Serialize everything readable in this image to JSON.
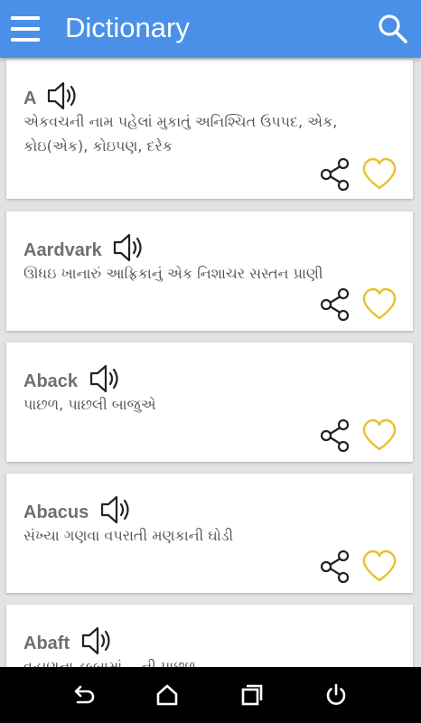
{
  "app": {
    "title": "Dictionary"
  },
  "icons": {
    "menu": "hamburger-menu-icon",
    "search": "search-icon",
    "speaker": "speaker-icon",
    "share": "share-icon",
    "favorite": "heart-icon"
  },
  "colors": {
    "appbar": "#4a90e8",
    "heart": "#e6c229",
    "word": "#6f6f6f",
    "meaning": "#555555"
  },
  "entries": [
    {
      "word": "A",
      "meaning": "એકવચની નામ પહેલાં મુકાતું અનિશ્ચિત ઉપપદ, એક, કોઇ(એક), કોઇપણ, દરેક"
    },
    {
      "word": "Aardvark",
      "meaning": "ઊધઇ ખાનારું આફ્રિકાનું એક નિશાચર સસ્તન પ્રાણી"
    },
    {
      "word": "Aback",
      "meaning": "પાછળ, પાછલી બાજુએ"
    },
    {
      "word": "Abacus",
      "meaning": "સંખ્યા ગણવા વપરાતી મણકાની ઘોડી"
    },
    {
      "word": "Abaft",
      "meaning": "વહાણના ડબ્બામાં __ની પાછળ"
    }
  ],
  "navbar": [
    "back-icon",
    "home-icon",
    "recents-icon",
    "power-icon"
  ]
}
